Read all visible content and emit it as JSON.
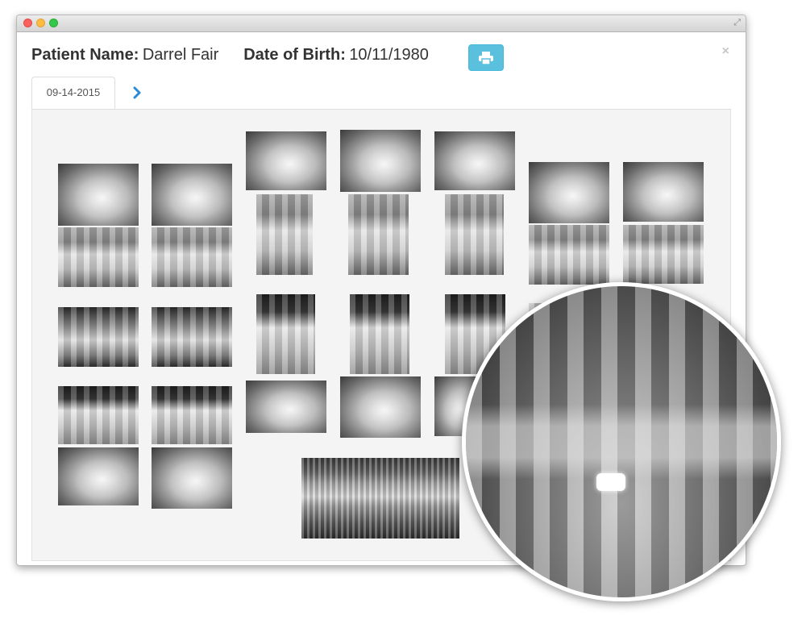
{
  "window": {
    "close_label": "×"
  },
  "patient": {
    "name_label": "Patient Name:",
    "name_value": "Darrel Fair",
    "dob_label": "Date of Birth:",
    "dob_value": "10/11/1980"
  },
  "toolbar": {
    "print_icon": "print-icon"
  },
  "tabs": {
    "active_label": "09-14-2015",
    "next_icon": "chevron-right-icon"
  },
  "series": {
    "thumbnails": [
      "intraoral-photo",
      "intraoral-photo",
      "bitewing",
      "bitewing",
      "periapical",
      "periapical",
      "periapical",
      "intraoral-photo",
      "panoramic"
    ]
  },
  "magnifier": {
    "content": "panoramic-xray-zoom"
  },
  "colors": {
    "primary_button": "#5bc0de",
    "panel_bg": "#f4f4f4",
    "text": "#333333"
  }
}
